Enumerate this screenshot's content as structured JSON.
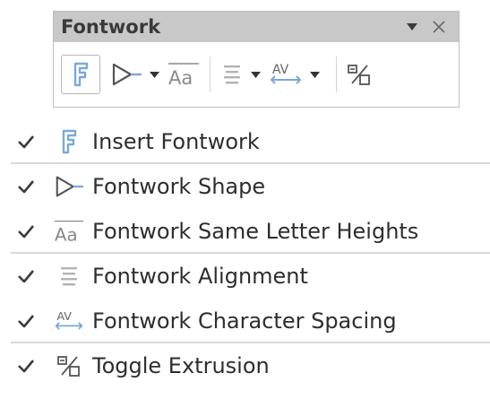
{
  "toolbar": {
    "title": "Fontwork",
    "icon_color": "#7aa9d8"
  },
  "menu": {
    "items": [
      {
        "label": "Insert Fontwork",
        "checked": true,
        "icon": "fontwork-f-icon"
      },
      {
        "label": "Fontwork Shape",
        "checked": true,
        "icon": "fontwork-shape-icon"
      },
      {
        "label": "Fontwork Same Letter Heights",
        "checked": true,
        "icon": "same-letter-heights-icon"
      },
      {
        "label": "Fontwork Alignment",
        "checked": true,
        "icon": "alignment-icon"
      },
      {
        "label": "Fontwork Character Spacing",
        "checked": true,
        "icon": "character-spacing-icon"
      },
      {
        "label": "Toggle Extrusion",
        "checked": true,
        "icon": "toggle-extrusion-icon"
      }
    ]
  }
}
